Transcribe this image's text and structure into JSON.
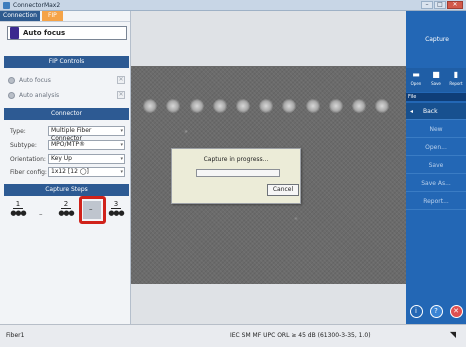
{
  "window": {
    "title": "ConnectorMax2"
  },
  "tabs": [
    {
      "label": "Connection"
    },
    {
      "label": "FIP"
    }
  ],
  "mode": {
    "label": "Auto focus"
  },
  "fip_controls": {
    "header": "FIP Controls",
    "options": [
      {
        "label": "Auto focus"
      },
      {
        "label": "Auto analysis"
      }
    ]
  },
  "connector": {
    "header": "Connector",
    "fields": [
      {
        "label": "Type:",
        "value": "Multiple Fiber Connector"
      },
      {
        "label": "Subtype:",
        "value": "MPO/MTP®"
      },
      {
        "label": "Orientation:",
        "value": "Key Up"
      },
      {
        "label": "Fiber config:",
        "value": "1x12 [12 ◯]"
      }
    ]
  },
  "capture_steps": {
    "header": "Capture Steps",
    "steps": [
      {
        "num": "1"
      },
      {
        "num": "2"
      },
      {
        "num": "3"
      }
    ],
    "current": "–"
  },
  "dialog": {
    "message": "Capture in progress...",
    "cancel": "Cancel",
    "progress": 0
  },
  "right_panel": {
    "capture": "Capture",
    "icons": [
      {
        "name": "open",
        "label": "Open"
      },
      {
        "name": "save",
        "label": "Save"
      },
      {
        "name": "report",
        "label": "Report"
      }
    ],
    "file_label": "File",
    "menu": [
      "Back",
      "New",
      "Open...",
      "Save",
      "Save As...",
      "Report..."
    ]
  },
  "status": {
    "left": "Fiber1",
    "center": "IEC SM MF UPC ORL ≥ 45 dB (61300-3-35, 1.0)"
  },
  "colors": {
    "accent": "#2367b5",
    "highlight": "#d0221a",
    "fip_tab": "#f5a347"
  }
}
